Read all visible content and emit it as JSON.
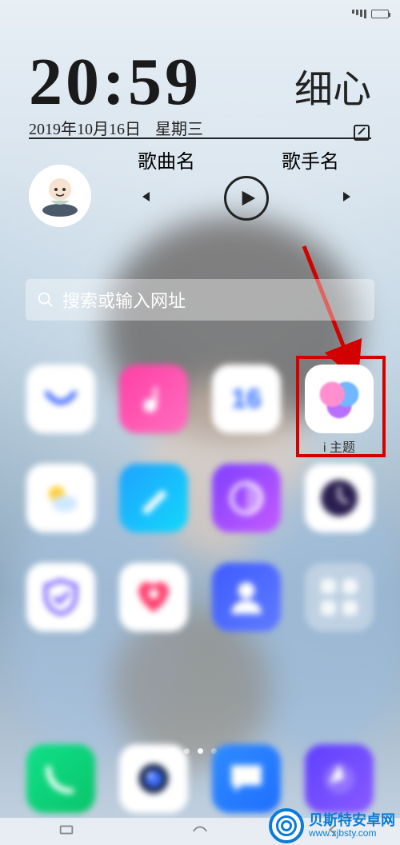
{
  "status": {
    "battery_pct": 80
  },
  "clock": {
    "time": "20:59",
    "date": "2019年10月16日",
    "weekday": "星期三",
    "right_label": "细心"
  },
  "music": {
    "song_label": "歌曲名",
    "artist_label": "歌手名"
  },
  "search": {
    "placeholder": "搜索或输入网址"
  },
  "apps": {
    "row1": [
      {
        "name": "vivo-store",
        "label": ""
      },
      {
        "name": "music",
        "label": ""
      },
      {
        "name": "calendar",
        "label": "",
        "day": "16"
      },
      {
        "name": "theme",
        "label": "i 主题"
      }
    ],
    "row2": [
      {
        "name": "weather",
        "label": ""
      },
      {
        "name": "notes",
        "label": ""
      },
      {
        "name": "gallery",
        "label": ""
      },
      {
        "name": "clock",
        "label": ""
      }
    ],
    "row3": [
      {
        "name": "security",
        "label": ""
      },
      {
        "name": "health",
        "label": ""
      },
      {
        "name": "contacts",
        "label": ""
      },
      {
        "name": "more",
        "label": ""
      }
    ]
  },
  "pager": {
    "count": 5,
    "active": 2
  },
  "dock": [
    {
      "name": "phone"
    },
    {
      "name": "camera"
    },
    {
      "name": "messages"
    },
    {
      "name": "browser"
    }
  ],
  "watermark": {
    "brand": "贝斯特安卓网",
    "url": "www.zjbsty.com"
  }
}
